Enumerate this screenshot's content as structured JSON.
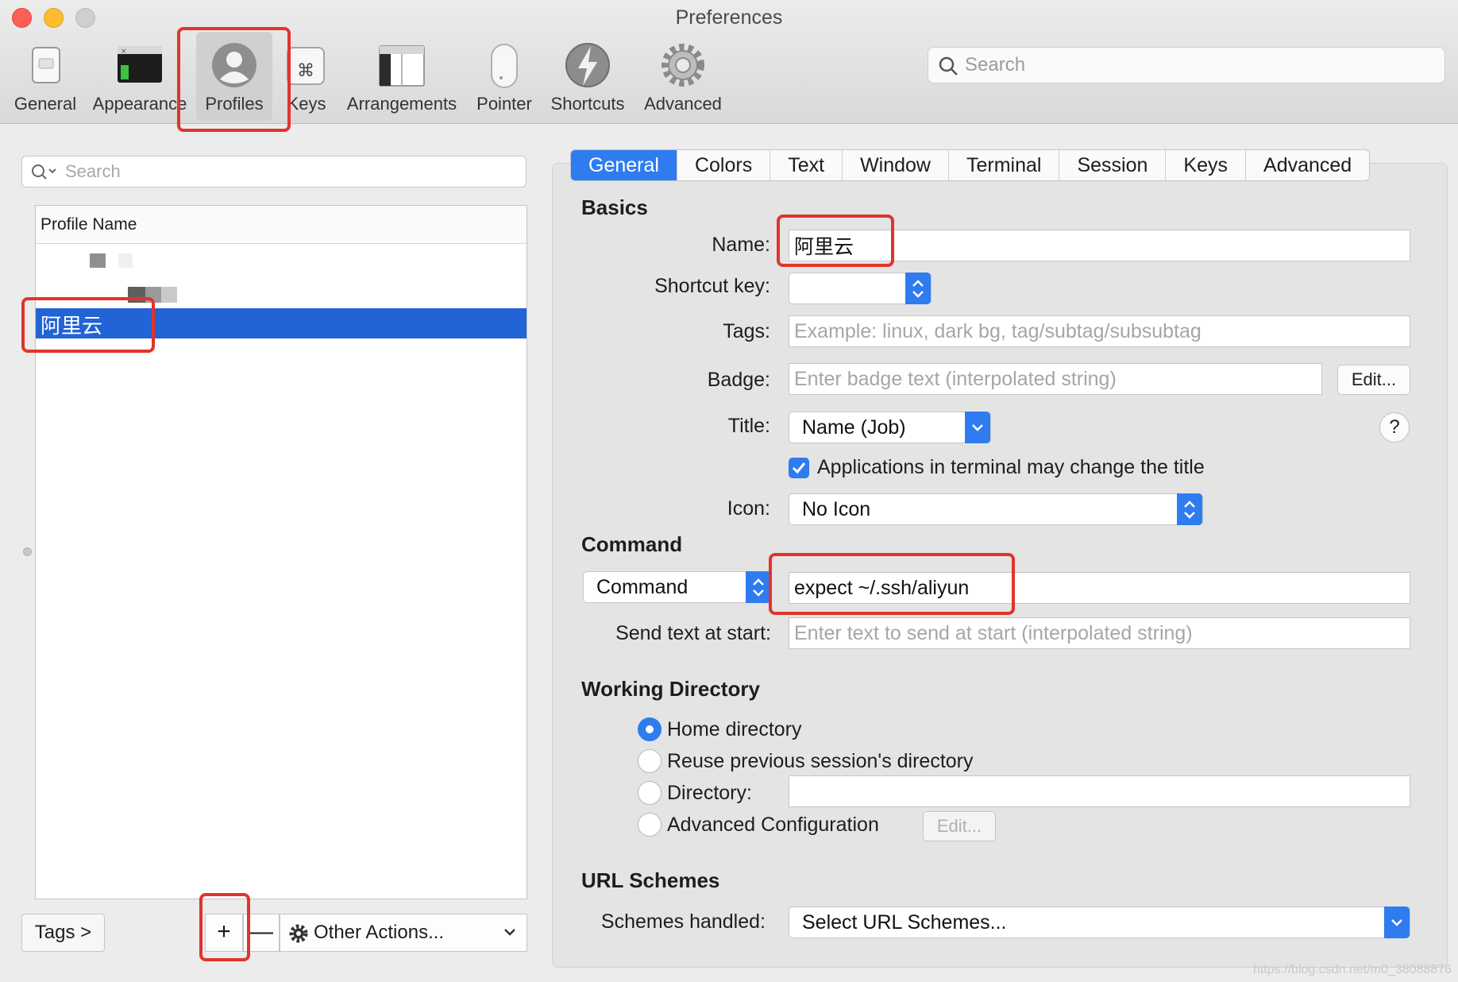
{
  "window": {
    "title": "Preferences"
  },
  "toolbar": {
    "items": [
      {
        "label": "General",
        "icon": "general-icon"
      },
      {
        "label": "Appearance",
        "icon": "appearance-icon"
      },
      {
        "label": "Profiles",
        "icon": "profiles-icon",
        "selected": true
      },
      {
        "label": "Keys",
        "icon": "keys-icon"
      },
      {
        "label": "Arrangements",
        "icon": "arrangements-icon"
      },
      {
        "label": "Pointer",
        "icon": "pointer-icon"
      },
      {
        "label": "Shortcuts",
        "icon": "shortcuts-icon"
      },
      {
        "label": "Advanced",
        "icon": "advanced-gear-icon"
      }
    ],
    "search_placeholder": "Search"
  },
  "profiles": {
    "search_placeholder": "Search",
    "header": "Profile Name",
    "rows": [
      {
        "label": "",
        "redacted": true
      },
      {
        "label": "",
        "redacted": true
      },
      {
        "label": "阿里云",
        "selected": true
      }
    ],
    "tags_button": "Tags >",
    "add_button": "+",
    "remove_button": "—",
    "other_actions": "Other Actions..."
  },
  "tabs": [
    "General",
    "Colors",
    "Text",
    "Window",
    "Terminal",
    "Session",
    "Keys",
    "Advanced"
  ],
  "active_tab": "General",
  "basics": {
    "title": "Basics",
    "name_label": "Name:",
    "name_value": "阿里云",
    "shortcut_label": "Shortcut key:",
    "shortcut_value": "",
    "tags_label": "Tags:",
    "tags_placeholder": "Example: linux, dark bg, tag/subtag/subsubtag",
    "badge_label": "Badge:",
    "badge_placeholder": "Enter badge text (interpolated string)",
    "badge_edit": "Edit...",
    "title_label": "Title:",
    "title_value": "Name (Job)",
    "help": "?",
    "title_checkbox": "Applications in terminal may change the title",
    "title_checkbox_checked": true,
    "icon_label": "Icon:",
    "icon_value": "No Icon"
  },
  "command": {
    "title": "Command",
    "mode": "Command",
    "value": "expect ~/.ssh/aliyun",
    "send_text_label": "Send text at start:",
    "send_text_placeholder": "Enter text to send at start (interpolated string)"
  },
  "working_directory": {
    "title": "Working Directory",
    "options": [
      {
        "label": "Home directory",
        "selected": true
      },
      {
        "label": "Reuse previous session's directory",
        "selected": false
      },
      {
        "label": "Directory:",
        "selected": false
      },
      {
        "label": "Advanced Configuration",
        "selected": false
      }
    ],
    "directory_value": "",
    "edit_button": "Edit..."
  },
  "url_schemes": {
    "title": "URL Schemes",
    "label": "Schemes handled:",
    "value": "Select URL Schemes..."
  },
  "watermark": "https://blog.csdn.net/m0_38088876",
  "colors": {
    "accent": "#2e7cf0",
    "selection": "#2263d5",
    "annotation": "#e0352b"
  }
}
